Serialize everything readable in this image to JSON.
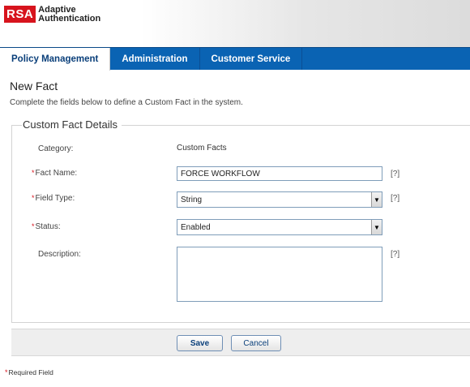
{
  "brand": {
    "logo_mark": "RSA",
    "product_line1": "Adaptive",
    "product_line2": "Authentication",
    "accent_color": "#d7141d"
  },
  "tabs": [
    {
      "label": "Policy Management",
      "active": true
    },
    {
      "label": "Administration",
      "active": false
    },
    {
      "label": "Customer Service",
      "active": false
    }
  ],
  "page": {
    "title": "New Fact",
    "description": "Complete the fields below to define a Custom Fact in the system."
  },
  "form": {
    "legend": "Custom Fact Details",
    "required_marker": "*",
    "category": {
      "label": "Category:",
      "value": "Custom Facts"
    },
    "fact_name": {
      "label": "Fact Name:",
      "value": "FORCE WORKFLOW",
      "help": "[?]"
    },
    "field_type": {
      "label": "Field Type:",
      "value": "String",
      "help": "[?]"
    },
    "status": {
      "label": "Status:",
      "value": "Enabled"
    },
    "description": {
      "label": "Description:",
      "value": "",
      "help": "[?]"
    }
  },
  "buttons": {
    "save": "Save",
    "cancel": "Cancel"
  },
  "footnote": {
    "marker": "*",
    "text": "Required Field"
  }
}
